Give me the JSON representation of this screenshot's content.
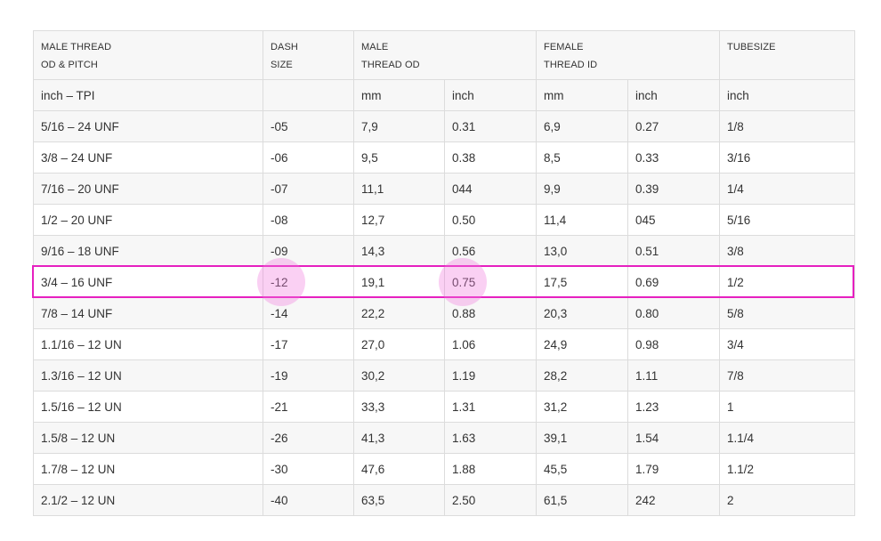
{
  "table": {
    "header_top": [
      {
        "line1": "MALE THREAD",
        "line2": "OD & PITCH"
      },
      {
        "line1": "DASH",
        "line2": "SIZE"
      },
      {
        "line1": "MALE",
        "line2": "THREAD OD"
      },
      {
        "line1": "FEMALE",
        "line2": "THREAD ID"
      },
      {
        "line1": "TUBESIZE",
        "line2": ""
      }
    ],
    "header_units": [
      "inch – TPI",
      "",
      "mm",
      "inch",
      "mm",
      "inch",
      "inch"
    ],
    "rows": [
      [
        "5/16 – 24 UNF",
        "-05",
        "7,9",
        "0.31",
        "6,9",
        "0.27",
        "1/8"
      ],
      [
        "3/8 – 24 UNF",
        "-06",
        "9,5",
        "0.38",
        "8,5",
        "0.33",
        "3/16"
      ],
      [
        "7/16 – 20 UNF",
        "-07",
        "11,1",
        "044",
        "9,9",
        "0.39",
        "1/4"
      ],
      [
        "1/2 – 20 UNF",
        "-08",
        "12,7",
        "0.50",
        "11,4",
        "045",
        "5/16"
      ],
      [
        "9/16 – 18 UNF",
        "-09",
        "14,3",
        "0.56",
        "13,0",
        "0.51",
        "3/8"
      ],
      [
        "3/4 – 16 UNF",
        "-12",
        "19,1",
        "0.75",
        "17,5",
        "0.69",
        "1/2"
      ],
      [
        "7/8 – 14 UNF",
        "-14",
        "22,2",
        "0.88",
        "20,3",
        "0.80",
        "5/8"
      ],
      [
        "1.1/16 – 12 UN",
        "-17",
        "27,0",
        "1.06",
        "24,9",
        "0.98",
        "3/4"
      ],
      [
        "1.3/16 – 12 UN",
        "-19",
        "30,2",
        "1.19",
        "28,2",
        "1.11",
        "7/8"
      ],
      [
        "1.5/16 – 12 UN",
        "-21",
        "33,3",
        "1.31",
        "31,2",
        "1.23",
        "1"
      ],
      [
        "1.5/8 – 12 UN",
        "-26",
        "41,3",
        "1.63",
        "39,1",
        "1.54",
        "1.1/4"
      ],
      [
        "1.7/8 – 12 UN",
        "-30",
        "47,6",
        "1.88",
        "45,5",
        "1.79",
        "1.1/2"
      ],
      [
        "2.1/2 – 12 UN",
        "-40",
        "63,5",
        "2.50",
        "61,5",
        "242",
        "2"
      ]
    ],
    "highlighted_row": 5
  },
  "colors": {
    "highlight_border": "#e620c0",
    "tap_marker": "#f078dc",
    "stripe": "#f7f7f7",
    "grid": "#dcdcdc",
    "text": "#333333"
  }
}
